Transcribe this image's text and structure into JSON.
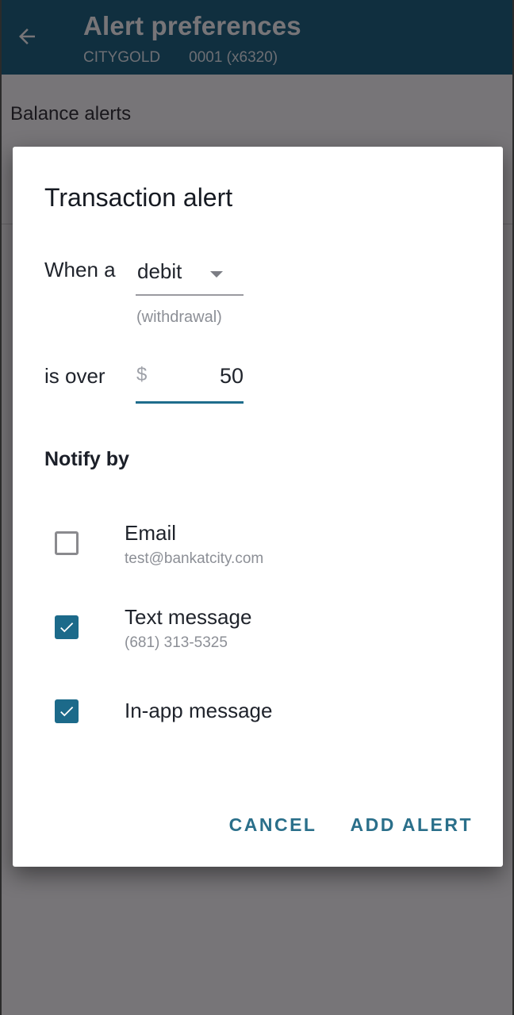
{
  "app_bar": {
    "title": "Alert preferences",
    "account_name": "CITYGOLD",
    "account_number": "0001 (x6320)",
    "back_icon": "arrow-left-icon",
    "color": "#0b5877"
  },
  "background": {
    "section_title": "Balance alerts"
  },
  "dialog": {
    "title": "Transaction alert",
    "when_label": "When a",
    "type_select": {
      "value": "debit",
      "helper": "(withdrawal)"
    },
    "amount_label": "is over",
    "amount": {
      "currency": "$",
      "value": "50"
    },
    "notify_title": "Notify by",
    "options": [
      {
        "label": "Email",
        "detail": "test@bankatcity.com",
        "checked": false
      },
      {
        "label": "Text message",
        "detail": "(681) 313-5325",
        "checked": true
      },
      {
        "label": "In-app message",
        "detail": "",
        "checked": true
      }
    ],
    "actions": {
      "cancel": "CANCEL",
      "confirm": "ADD ALERT"
    },
    "accent": "#1c6a8a"
  }
}
